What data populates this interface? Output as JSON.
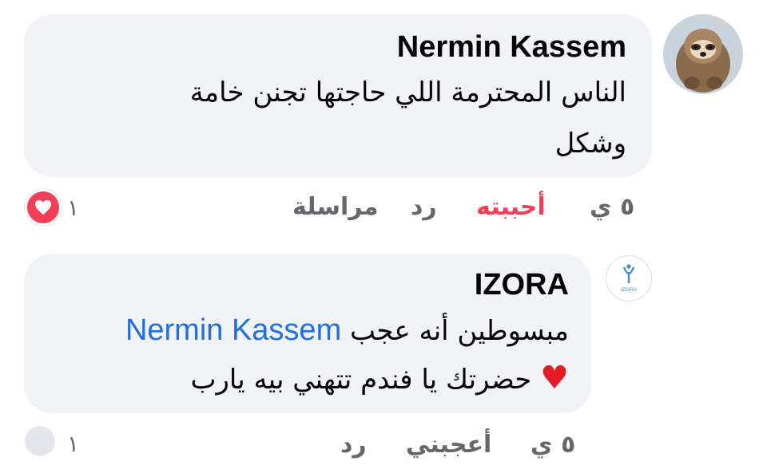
{
  "comments": [
    {
      "author": "Nermin Kassem",
      "lines": [
        "الناس المحترمة اللي حاجتها تجنن خامة",
        "وشكل"
      ],
      "time": "٥ ي",
      "actions": {
        "like": "أحببته",
        "reply": "رد",
        "message": "مراسلة"
      },
      "reaction_count": "١",
      "reaction_type": "love",
      "colors": {
        "like_active": "#f33e58"
      }
    },
    {
      "author": "IZORA",
      "avatar_text": "IZORA",
      "line1_text": "مبسوطين أنه عجب",
      "line1_mention": "Nermin Kassem",
      "line2_text": "حضرتك يا فندم تتهني بيه يارب",
      "line2_emoji": "♥",
      "time": "٥ ي",
      "actions": {
        "like": "أعجبني",
        "reply": "رد"
      },
      "reaction_count": "١",
      "colors": {
        "mention": "#216fdb"
      }
    }
  ]
}
